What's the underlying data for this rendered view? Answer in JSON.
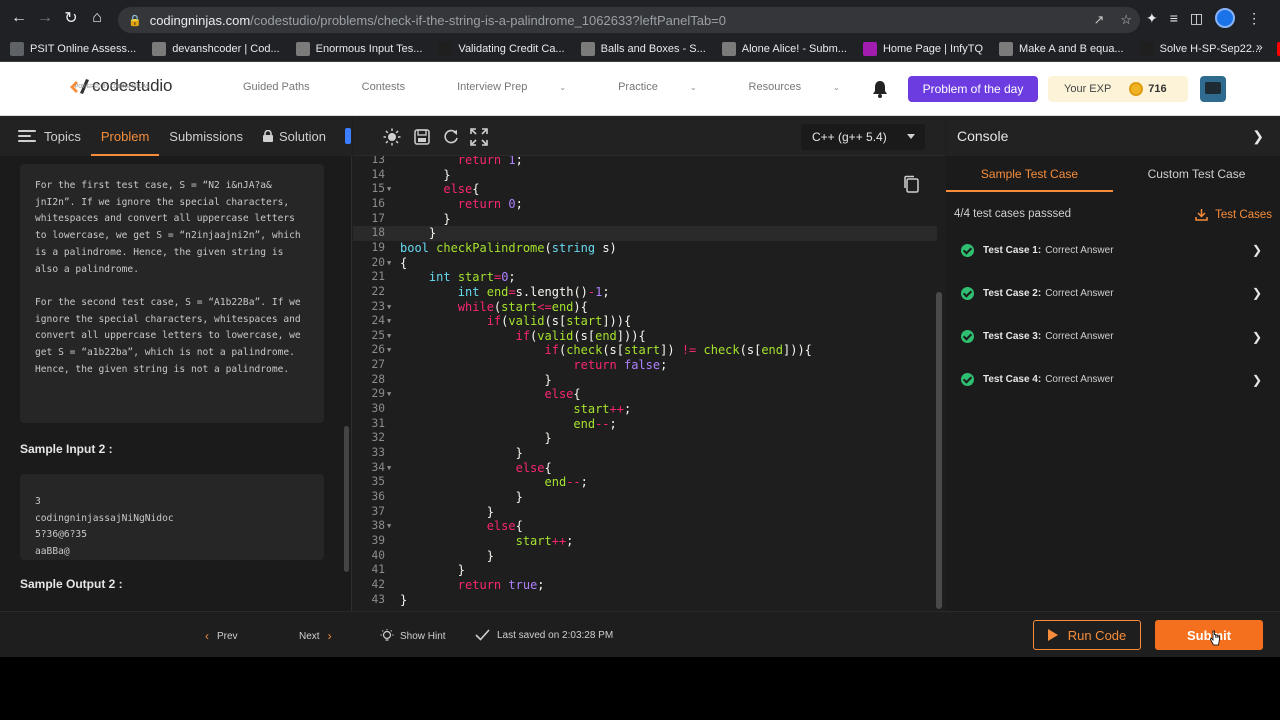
{
  "browser": {
    "url_host": "codingninjas.com",
    "url_path": "/codestudio/problems/check-if-the-string-is-a-palindrome_1062633?leftPanelTab=0",
    "bookmarks": [
      {
        "label": "PSIT Online Assess...",
        "color": "#5f6368",
        "icon": "globe-icon"
      },
      {
        "label": "devanshcoder | Cod...",
        "color": "#7b7b7b",
        "icon": "cc-icon"
      },
      {
        "label": "Enormous Input Tes...",
        "color": "#7b7b7b",
        "icon": "cc-icon"
      },
      {
        "label": "Validating Credit Ca...",
        "color": "#1f1f1f",
        "icon": "hr-icon"
      },
      {
        "label": "Balls and Boxes - S...",
        "color": "#7b7b7b",
        "icon": "cc-icon"
      },
      {
        "label": "Alone Alice! - Subm...",
        "color": "#7b7b7b",
        "icon": "cc-icon"
      },
      {
        "label": "Home Page | InfyTQ",
        "color": "#a21caf",
        "icon": "infytq-icon"
      },
      {
        "label": "Make A and B equa...",
        "color": "#7b7b7b",
        "icon": "cc-icon"
      },
      {
        "label": "Solve H-SP-Sep22...",
        "color": "#1f1f1f",
        "icon": "hr-icon"
      },
      {
        "label": "YouTube",
        "color": "#ff0000",
        "icon": "youtube-icon"
      }
    ]
  },
  "header": {
    "logo_text": "codestudio",
    "logo_sub": "POWERED BY CODING NINJAS",
    "nav": [
      {
        "label": "Guided Paths",
        "dropdown": false
      },
      {
        "label": "Contests",
        "dropdown": false
      },
      {
        "label": "Interview Prep",
        "dropdown": true
      },
      {
        "label": "Practice",
        "dropdown": true
      },
      {
        "label": "Resources",
        "dropdown": true
      }
    ],
    "potd_label": "Problem of the day",
    "exp_label": "Your EXP",
    "exp_points": "716"
  },
  "left": {
    "tabs": {
      "topics": "Topics",
      "problem": "Problem",
      "submissions": "Submissions",
      "solution": "Solution"
    },
    "explanation": [
      "For the first test case, S = “N2 i&nJA?a& jnI2n”. If we ignore the special characters, whitespaces and convert all uppercase letters to lowercase, we get S = “n2injaajni2n”, which is a palindrome. Hence, the given string is also a palindrome.",
      "For the second test case, S = “A1b22Ba”. If we ignore the special characters, whitespaces and convert all uppercase letters to lowercase, we get S = “a1b22ba”, which is not a palindrome. Hence, the given string is not a palindrome."
    ],
    "sample_input_title": "Sample Input 2 :",
    "sample_input_lines": [
      "3",
      "codingninjassajNiNgNidoc",
      "5?36@6?35",
      "aaBBa@"
    ],
    "sample_output_title": "Sample Output 2 :"
  },
  "editor": {
    "language": "C++ (g++ 5.4)",
    "lines": [
      {
        "n": "13",
        "fold": false,
        "segs": [
          [
            "        ",
            "pl"
          ],
          [
            "return",
            "kw"
          ],
          [
            " ",
            "pl"
          ],
          [
            "1",
            "nm"
          ],
          [
            ";",
            "pl"
          ]
        ]
      },
      {
        "n": "14",
        "fold": false,
        "segs": [
          [
            "      }",
            "pl"
          ]
        ]
      },
      {
        "n": "15",
        "fold": true,
        "segs": [
          [
            "      ",
            "pl"
          ],
          [
            "else",
            "kw"
          ],
          [
            "{",
            "pl"
          ]
        ]
      },
      {
        "n": "16",
        "fold": false,
        "segs": [
          [
            "        ",
            "pl"
          ],
          [
            "return",
            "kw"
          ],
          [
            " ",
            "pl"
          ],
          [
            "0",
            "nm"
          ],
          [
            ";",
            "pl"
          ]
        ]
      },
      {
        "n": "17",
        "fold": false,
        "segs": [
          [
            "      }",
            "pl"
          ]
        ]
      },
      {
        "n": "18",
        "fold": false,
        "hl": true,
        "segs": [
          [
            "    }",
            "pl"
          ]
        ]
      },
      {
        "n": "19",
        "fold": false,
        "segs": [
          [
            "bool",
            "ty"
          ],
          [
            " ",
            "pl"
          ],
          [
            "checkPalindrome",
            "fn"
          ],
          [
            "(",
            "pl"
          ],
          [
            "string",
            "ty"
          ],
          [
            " s)",
            "pl"
          ]
        ]
      },
      {
        "n": "20",
        "fold": true,
        "segs": [
          [
            "{",
            "pl"
          ]
        ]
      },
      {
        "n": "21",
        "fold": false,
        "segs": [
          [
            "    ",
            "pl"
          ],
          [
            "int",
            "ty"
          ],
          [
            " ",
            "pl"
          ],
          [
            "start",
            "fn"
          ],
          [
            "=",
            "kw"
          ],
          [
            "0",
            "nm"
          ],
          [
            ";",
            "pl"
          ]
        ]
      },
      {
        "n": "22",
        "fold": false,
        "segs": [
          [
            "        ",
            "pl"
          ],
          [
            "int",
            "ty"
          ],
          [
            " ",
            "pl"
          ],
          [
            "end",
            "fn"
          ],
          [
            "=",
            "kw"
          ],
          [
            "s.length()",
            "pl"
          ],
          [
            "-",
            "kw"
          ],
          [
            "1",
            "nm"
          ],
          [
            ";",
            "pl"
          ]
        ]
      },
      {
        "n": "23",
        "fold": true,
        "segs": [
          [
            "        ",
            "pl"
          ],
          [
            "while",
            "kw"
          ],
          [
            "(",
            "pl"
          ],
          [
            "start",
            "fn"
          ],
          [
            "<=",
            "kw"
          ],
          [
            "end",
            "fn"
          ],
          [
            "){",
            "pl"
          ]
        ]
      },
      {
        "n": "24",
        "fold": true,
        "segs": [
          [
            "            ",
            "pl"
          ],
          [
            "if",
            "kw"
          ],
          [
            "(",
            "pl"
          ],
          [
            "valid",
            "fn"
          ],
          [
            "(s[",
            "pl"
          ],
          [
            "start",
            "fn"
          ],
          [
            "])){",
            "pl"
          ]
        ]
      },
      {
        "n": "25",
        "fold": true,
        "segs": [
          [
            "                ",
            "pl"
          ],
          [
            "if",
            "kw"
          ],
          [
            "(",
            "pl"
          ],
          [
            "valid",
            "fn"
          ],
          [
            "(s[",
            "pl"
          ],
          [
            "end",
            "fn"
          ],
          [
            "])){",
            "pl"
          ]
        ]
      },
      {
        "n": "26",
        "fold": true,
        "segs": [
          [
            "                    ",
            "pl"
          ],
          [
            "if",
            "kw"
          ],
          [
            "(",
            "pl"
          ],
          [
            "check",
            "fn"
          ],
          [
            "(s[",
            "pl"
          ],
          [
            "start",
            "fn"
          ],
          [
            "]) ",
            "pl"
          ],
          [
            "!=",
            "kw"
          ],
          [
            " ",
            "pl"
          ],
          [
            "check",
            "fn"
          ],
          [
            "(s[",
            "pl"
          ],
          [
            "end",
            "fn"
          ],
          [
            "])){",
            "pl"
          ]
        ]
      },
      {
        "n": "27",
        "fold": false,
        "segs": [
          [
            "                        ",
            "pl"
          ],
          [
            "return",
            "kw"
          ],
          [
            " ",
            "pl"
          ],
          [
            "false",
            "nm"
          ],
          [
            ";",
            "pl"
          ]
        ]
      },
      {
        "n": "28",
        "fold": false,
        "segs": [
          [
            "                    }",
            "pl"
          ]
        ]
      },
      {
        "n": "29",
        "fold": true,
        "segs": [
          [
            "                    ",
            "pl"
          ],
          [
            "else",
            "kw"
          ],
          [
            "{",
            "pl"
          ]
        ]
      },
      {
        "n": "30",
        "fold": false,
        "segs": [
          [
            "                        ",
            "pl"
          ],
          [
            "start",
            "fn"
          ],
          [
            "++",
            "kw"
          ],
          [
            ";",
            "pl"
          ]
        ]
      },
      {
        "n": "31",
        "fold": false,
        "segs": [
          [
            "                        ",
            "pl"
          ],
          [
            "end",
            "fn"
          ],
          [
            "--",
            "kw"
          ],
          [
            ";",
            "pl"
          ]
        ]
      },
      {
        "n": "32",
        "fold": false,
        "segs": [
          [
            "                    }",
            "pl"
          ]
        ]
      },
      {
        "n": "33",
        "fold": false,
        "segs": [
          [
            "                }",
            "pl"
          ]
        ]
      },
      {
        "n": "34",
        "fold": true,
        "segs": [
          [
            "                ",
            "pl"
          ],
          [
            "else",
            "kw"
          ],
          [
            "{",
            "pl"
          ]
        ]
      },
      {
        "n": "35",
        "fold": false,
        "segs": [
          [
            "                    ",
            "pl"
          ],
          [
            "end",
            "fn"
          ],
          [
            "--",
            "kw"
          ],
          [
            ";",
            "pl"
          ]
        ]
      },
      {
        "n": "36",
        "fold": false,
        "segs": [
          [
            "                }",
            "pl"
          ]
        ]
      },
      {
        "n": "37",
        "fold": false,
        "segs": [
          [
            "            }",
            "pl"
          ]
        ]
      },
      {
        "n": "38",
        "fold": true,
        "segs": [
          [
            "            ",
            "pl"
          ],
          [
            "else",
            "kw"
          ],
          [
            "{",
            "pl"
          ]
        ]
      },
      {
        "n": "39",
        "fold": false,
        "segs": [
          [
            "                ",
            "pl"
          ],
          [
            "start",
            "fn"
          ],
          [
            "++",
            "kw"
          ],
          [
            ";",
            "pl"
          ]
        ]
      },
      {
        "n": "40",
        "fold": false,
        "segs": [
          [
            "            }",
            "pl"
          ]
        ]
      },
      {
        "n": "41",
        "fold": false,
        "segs": [
          [
            "        }",
            "pl"
          ]
        ]
      },
      {
        "n": "42",
        "fold": false,
        "segs": [
          [
            "        ",
            "pl"
          ],
          [
            "return",
            "kw"
          ],
          [
            " ",
            "pl"
          ],
          [
            "true",
            "nm"
          ],
          [
            ";",
            "pl"
          ]
        ]
      },
      {
        "n": "43",
        "fold": false,
        "segs": [
          [
            "}",
            "pl"
          ]
        ]
      }
    ]
  },
  "console": {
    "title": "Console",
    "tab_sample": "Sample Test Case",
    "tab_custom": "Custom Test Case",
    "summary": "4/4 test cases passsed",
    "download_label": "Test Cases",
    "cases": [
      {
        "name": "Test Case 1:",
        "result": "Correct Answer"
      },
      {
        "name": "Test Case 2:",
        "result": "Correct Answer"
      },
      {
        "name": "Test Case 3:",
        "result": "Correct Answer"
      },
      {
        "name": "Test Case 4:",
        "result": "Correct Answer"
      }
    ]
  },
  "footer": {
    "prev": "Prev",
    "next": "Next",
    "hint": "Show Hint",
    "saved": "Last saved on 2:03:28 PM",
    "run": "Run Code",
    "submit": "Submit"
  }
}
